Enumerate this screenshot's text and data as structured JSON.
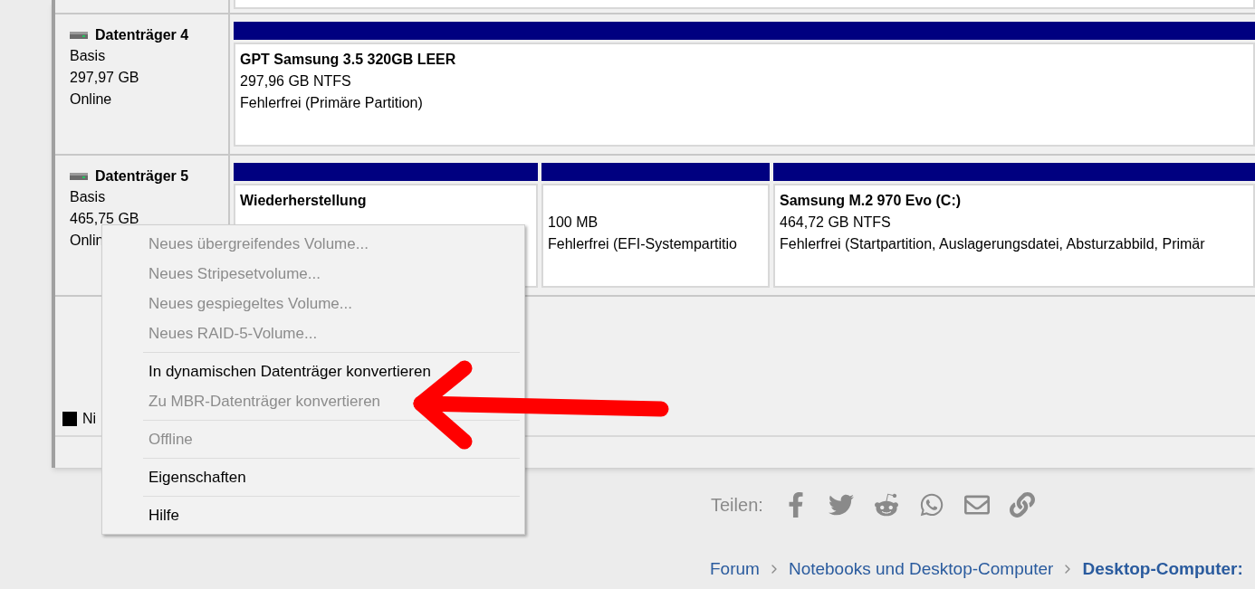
{
  "disks": [
    {
      "title": "Datenträger 4",
      "lines": [
        "Basis",
        "297,97 GB",
        "Online"
      ],
      "partitions": [
        {
          "name": "GPT Samsung 3.5 320GB LEER",
          "lines": [
            "297,96 GB NTFS",
            "Fehlerfrei (Primäre Partition)"
          ]
        }
      ]
    },
    {
      "title": "Datenträger 5",
      "lines": [
        "Basis",
        "465,75 GB",
        "Onlin"
      ],
      "partitions": [
        {
          "name": "Wiederherstellung"
        },
        {
          "lines": [
            "100 MB",
            "Fehlerfrei (EFI-Systempartitio"
          ]
        },
        {
          "name": "Samsung M.2 970 Evo  (C:)",
          "lines": [
            "464,72 GB NTFS",
            "Fehlerfrei (Startpartition, Auslagerungsdatei, Absturzabbild, Primär"
          ]
        }
      ]
    }
  ],
  "legend": {
    "label": "Ni"
  },
  "context_menu": {
    "groups": [
      [
        {
          "label": "Neues übergreifendes Volume...",
          "disabled": true
        },
        {
          "label": "Neues Stripesetvolume...",
          "disabled": true
        },
        {
          "label": "Neues gespiegeltes Volume...",
          "disabled": true
        },
        {
          "label": "Neues RAID-5-Volume...",
          "disabled": true
        }
      ],
      [
        {
          "label": "In dynamischen Datenträger konvertieren",
          "disabled": false
        },
        {
          "label": "Zu MBR-Datenträger konvertieren",
          "disabled": true
        }
      ],
      [
        {
          "label": "Offline",
          "disabled": true
        }
      ],
      [
        {
          "label": "Eigenschaften",
          "disabled": false
        }
      ],
      [
        {
          "label": "Hilfe",
          "disabled": false
        }
      ]
    ]
  },
  "share": {
    "label": "Teilen:",
    "icons": [
      {
        "kind": "facebook"
      },
      {
        "kind": "twitter"
      },
      {
        "kind": "reddit"
      },
      {
        "kind": "whatsapp"
      },
      {
        "kind": "email"
      },
      {
        "kind": "link"
      }
    ]
  },
  "breadcrumb": [
    {
      "label": "Forum",
      "current": false
    },
    {
      "label": "Notebooks und Desktop-Computer",
      "current": false
    },
    {
      "label": "Desktop-Computer:",
      "current": true
    }
  ]
}
